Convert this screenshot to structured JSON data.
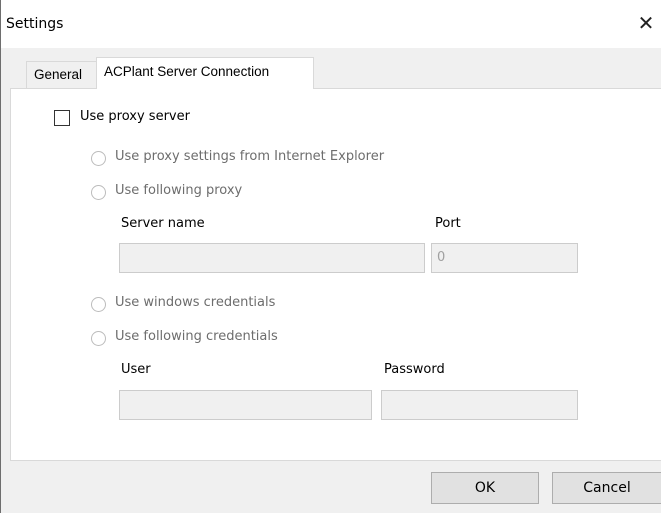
{
  "window": {
    "title": "Settings",
    "close_label": "✕"
  },
  "tabs": [
    {
      "label": "General",
      "selected": false
    },
    {
      "label": "ACPlant Server Connection",
      "selected": true
    }
  ],
  "proxy": {
    "use_proxy_label": "Use proxy server",
    "use_proxy_checked": false,
    "radio_ie_label": "Use proxy settings from Internet Explorer",
    "radio_following_proxy_label": "Use following proxy",
    "server_name_label": "Server name",
    "server_name_value": "",
    "port_label": "Port",
    "port_value": "0",
    "radio_windows_credentials_label": "Use windows credentials",
    "radio_following_credentials_label": "Use following credentials",
    "user_label": "User",
    "user_value": "",
    "password_label": "Password",
    "password_value": ""
  },
  "buttons": {
    "ok_label": "OK",
    "cancel_label": "Cancel"
  }
}
